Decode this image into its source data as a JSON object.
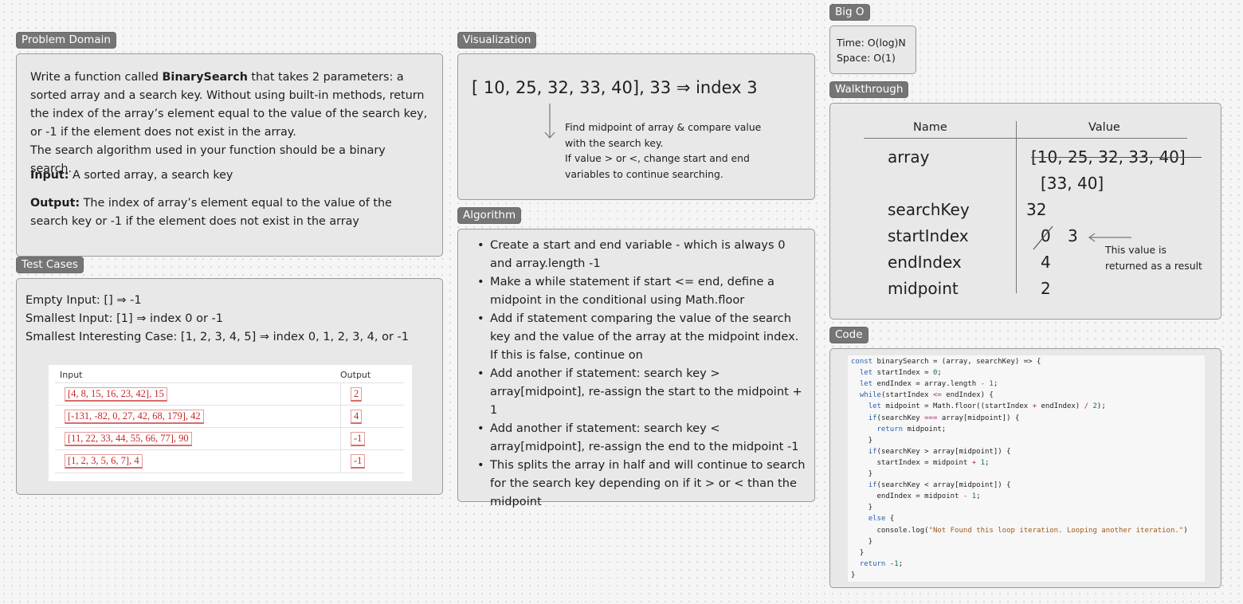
{
  "labels": {
    "problem_domain": "Problem Domain",
    "test_cases": "Test Cases",
    "visualization": "Visualization",
    "algorithm": "Algorithm",
    "big_o": "Big O",
    "walkthrough": "Walkthrough",
    "code": "Code"
  },
  "problem_domain": {
    "para1_pre": "Write a function called ",
    "para1_bold": "BinarySearch",
    "para1_post": " that takes 2 parameters: a sorted array and a search key. Without using built-in methods, return the index of the array’s element equal to the value of the search key, or -1 if the element does not exist in the array.",
    "para2": "The search algorithm used in your function should be a binary search.",
    "input_label": "Input:",
    "input_text": " A sorted array, a search key",
    "output_label": "Output:",
    "output_text": " The index of array’s element equal to the value of the search key or -1 if the element does not exist in the array"
  },
  "test_cases": {
    "lines": [
      "Empty Input: [] ⇒ -1",
      "Smallest Input: [1] ⇒ index 0 or -1",
      "Smallest Interesting Case: [1, 2, 3, 4, 5] ⇒ index 0, 1, 2, 3, 4, or -1"
    ],
    "table_headers": [
      "Input",
      "Output"
    ],
    "rows": [
      {
        "input": "[4, 8, 15, 16, 23, 42], 15",
        "output": "2"
      },
      {
        "input": "[-131, -82, 0, 27, 42, 68, 179], 42",
        "output": "4"
      },
      {
        "input": "[11, 22, 33, 44, 55, 66, 77], 90",
        "output": "-1"
      },
      {
        "input": "[1, 2, 3, 5, 6, 7], 4",
        "output": "-1"
      }
    ]
  },
  "visualization": {
    "title": "[ 10, 25, 32, 33, 40], 33 ⇒ index 3",
    "note_lines": [
      "Find midpoint of array & compare value",
      "with the search key.",
      "If value > or <, change start and end",
      "variables to continue searching."
    ]
  },
  "algorithm": {
    "items": [
      "Create a start and end variable - which is always 0 and array.length -1",
      "Make a while statement if start <= end, define a midpoint in the conditional using Math.floor",
      "Add if statement comparing the value of the search key and the value of the array at the midpoint index. If this is false, continue on",
      "Add another if statement: search key > array[midpoint], re-assign the start to the midpoint + 1",
      "Add another if statement: search key < array[midpoint], re-assign the end to the midpoint -1",
      "This splits the array in half and will continue to search for the search key depending on if it > or < than the midpoint"
    ]
  },
  "big_o": {
    "time": "Time: O(log)N",
    "space": "Space: O(1)"
  },
  "walkthrough": {
    "header_name": "Name",
    "header_value": "Value",
    "rows": [
      {
        "name": "array",
        "values": [
          "[10, 25, 32, 33, 40]",
          "[33, 40]"
        ]
      },
      {
        "name": "searchKey",
        "values": [
          "32"
        ]
      },
      {
        "name": "startIndex",
        "values": [
          "0",
          "3"
        ]
      },
      {
        "name": "endIndex",
        "values": [
          "4"
        ]
      },
      {
        "name": "midpoint",
        "values": [
          "2"
        ]
      }
    ],
    "note_lines": [
      "This value is",
      "returned as a result"
    ]
  },
  "code": {
    "lines": [
      "const binarySearch = (array, searchKey) => {",
      "  let startIndex = 0;",
      "  let endIndex = array.length - 1;",
      "  while(startIndex <= endIndex) {",
      "    let midpoint = Math.floor((startIndex + endIndex) / 2);",
      "    if(searchKey === array[midpoint]) {",
      "      return midpoint;",
      "    }",
      "    if(searchKey > array[midpoint]) {",
      "      startIndex = midpoint + 1;",
      "    }",
      "    if(searchKey < array[midpoint]) {",
      "      endIndex = midpoint - 1;",
      "    }",
      "    else {",
      "      console.log(\"Not Found this loop iteration. Looping another iteration.\")",
      "    }",
      "  }",
      "  return -1;",
      "}"
    ]
  }
}
